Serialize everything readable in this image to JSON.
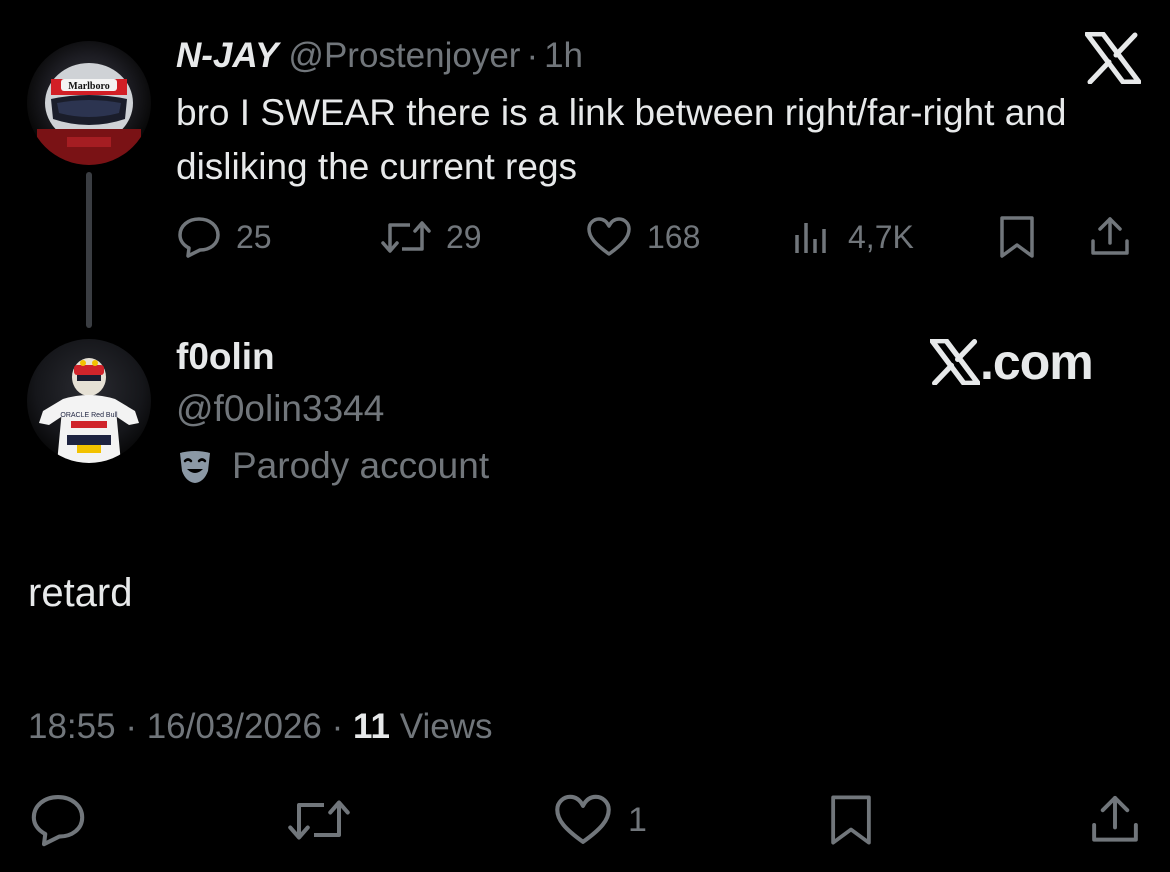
{
  "parent_tweet": {
    "display_name": "N-JAY",
    "handle": "@Prostenjoyer",
    "separator": "·",
    "time": "1h",
    "text": "bro I SWEAR there is a link between right/far-right and disliking the current regs",
    "avatar_icon": "driver-helmet-avatar",
    "avatar_text": "Marlboro",
    "stats": {
      "replies": "25",
      "reposts": "29",
      "likes": "168",
      "views": "4,7K"
    }
  },
  "reply": {
    "display_name": "f0olin",
    "handle": "@f0olin3344",
    "badge_label": "Parody account",
    "badge_icon": "mask-icon",
    "text": "retard",
    "time": "18:55",
    "date": "16/03/2026",
    "view_count": "11",
    "views_label": "Views",
    "separator": "·",
    "likes": "1",
    "avatar_icon": "racing-driver-avatar",
    "avatar_text": "ORACLE Red Bull"
  },
  "watermark": {
    "logo_icon": "x-logo",
    "site_suffix": ".com"
  },
  "colors": {
    "background": "#000000",
    "text_primary": "#e7e9ea",
    "text_secondary": "#71767b",
    "thread_line": "#3a3d42"
  }
}
